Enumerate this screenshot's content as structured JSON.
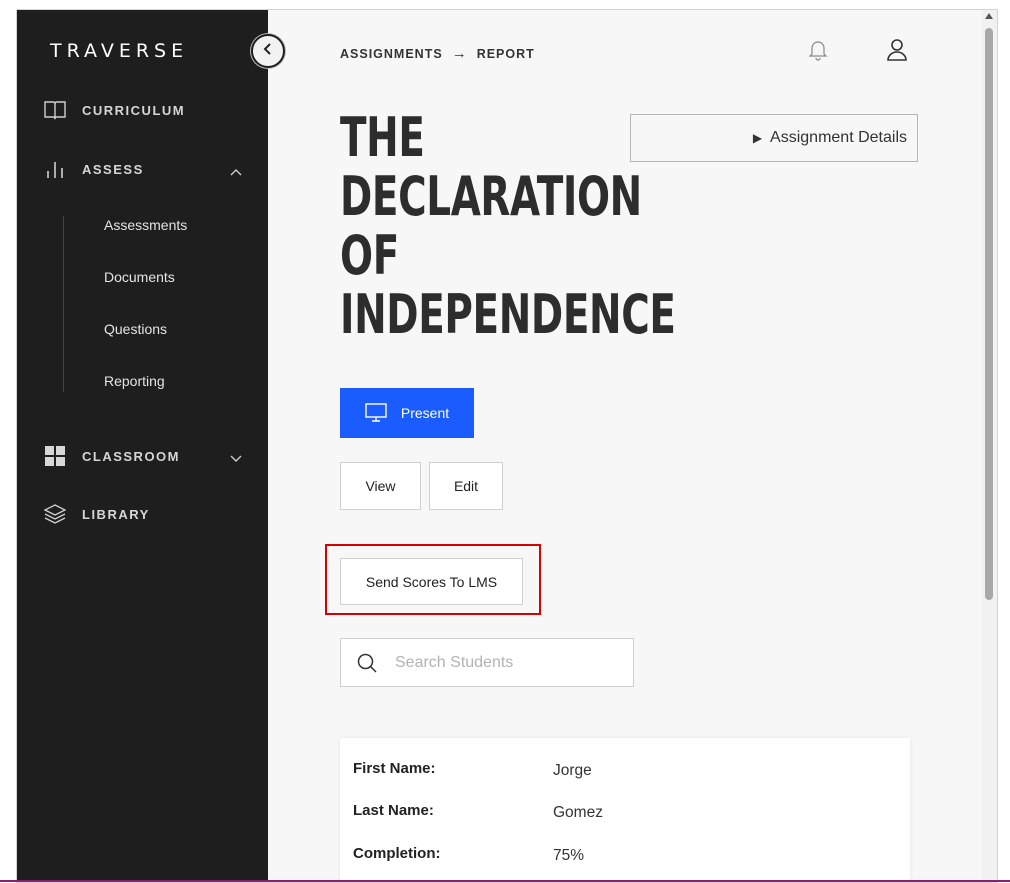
{
  "sidebar": {
    "logo": "TRAVERSE",
    "collapse_icon": "chevron-left-icon",
    "items": [
      {
        "label": "CURRICULUM",
        "icon": "book-icon"
      },
      {
        "label": "ASSESS",
        "icon": "bar-chart-icon",
        "expanded": true
      },
      {
        "label": "CLASSROOM",
        "icon": "grid-icon",
        "expanded": false
      },
      {
        "label": "LIBRARY",
        "icon": "layers-icon"
      }
    ],
    "assess_subitems": [
      "Assessments",
      "Documents",
      "Questions",
      "Reporting"
    ]
  },
  "header": {
    "breadcrumb": [
      "ASSIGNMENTS",
      "REPORT"
    ],
    "breadcrumb_separator": "→"
  },
  "main": {
    "title_lines": [
      "THE",
      "DECLARATION",
      "OF",
      "INDEPENDENCE"
    ],
    "details_label": "Assignment Details",
    "present_label": "Present",
    "view_label": "View",
    "edit_label": "Edit",
    "send_scores_label": "Send Scores To LMS",
    "search_placeholder": "Search Students"
  },
  "student": {
    "fields": [
      {
        "label": "First Name:",
        "value": "Jorge"
      },
      {
        "label": "Last Name:",
        "value": "Gomez"
      },
      {
        "label": "Completion:",
        "value": "75%"
      }
    ]
  },
  "colors": {
    "sidebar_bg": "#1e1e1e",
    "accent": "#1a5cff",
    "highlight": "#d60000"
  }
}
